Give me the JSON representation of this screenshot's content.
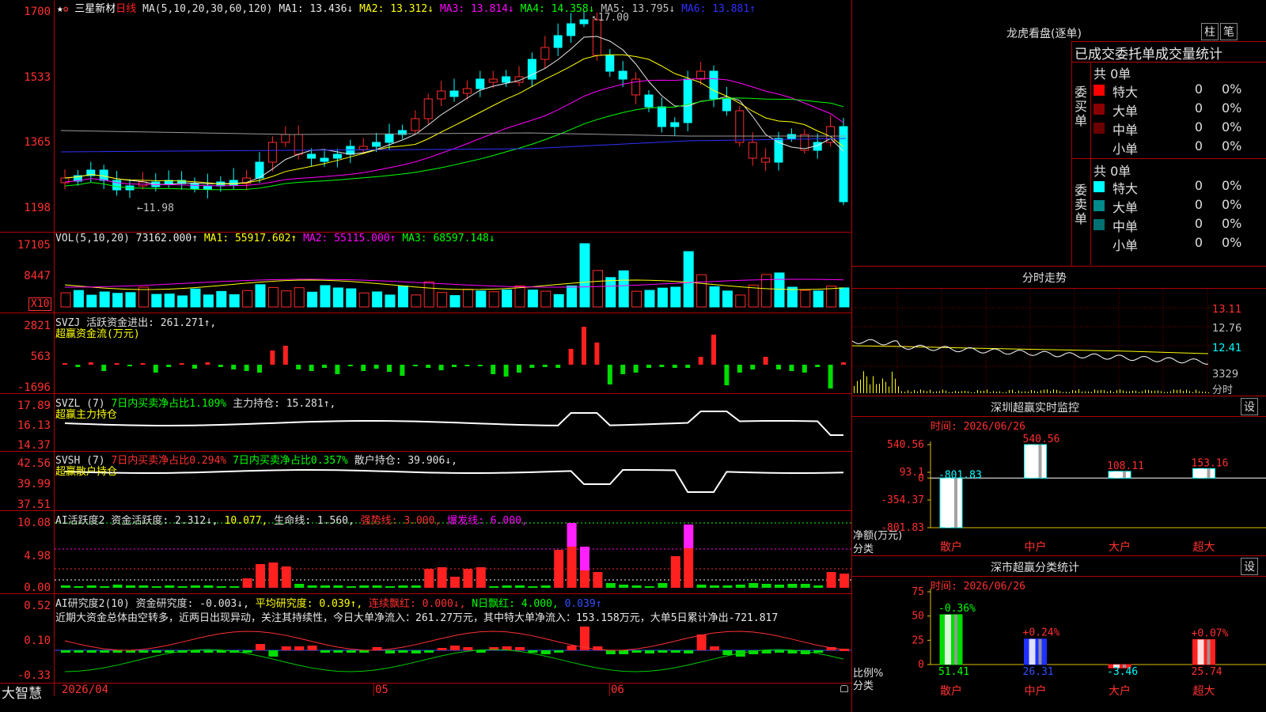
{
  "stock": {
    "name": "三星新材",
    "period": "日线",
    "star": "★",
    "gear": "⚙"
  },
  "ma_header": {
    "prefix": "MA(5,10,20,30,60,120)",
    "items": [
      {
        "t": "MA1: 13.436↓",
        "c": "#e8e8e8"
      },
      {
        "t": "MA2: 13.312↓",
        "c": "#ffff00"
      },
      {
        "t": "MA3: 13.814↓",
        "c": "#ff00ff"
      },
      {
        "t": "MA4: 14.358↓",
        "c": "#00ff00"
      },
      {
        "t": "MA5: 13.795↓",
        "c": "#c0c0c0"
      },
      {
        "t": "MA6: 13.881↑",
        "c": "#3030ff"
      }
    ],
    "high_mark": "17.00",
    "low_mark": "11.98"
  },
  "price_axis": [
    "1700",
    "1533",
    "1365",
    "1198"
  ],
  "vol_header": {
    "prefix": "VOL(5,10,20)",
    "items": [
      {
        "t": "73162.000↑",
        "c": "#e8e8e8"
      },
      {
        "t": "MA1: 55917.602↑",
        "c": "#ffff00"
      },
      {
        "t": "MA2: 55115.000↑",
        "c": "#ff00ff"
      },
      {
        "t": "MA3: 68597.148↓",
        "c": "#00ff00"
      }
    ]
  },
  "vol_axis": [
    "17105",
    "8447"
  ],
  "vol_unit": "X10",
  "svzj": {
    "line1": "SVZJ  活跃资金进出: 261.271↑,",
    "line2": "超赢资金流(万元)"
  },
  "svzj_axis": [
    "2821",
    "563",
    "-1696"
  ],
  "svzl": {
    "name": "SVZL (7)",
    "a": "7日内买卖净占比1.109%",
    "b": "主力持仓: 15.281↑,",
    "line2": "超赢主力持仓"
  },
  "svzl_axis": [
    "17.89",
    "16.13",
    "14.37"
  ],
  "svsh": {
    "name": "SVSH (7)",
    "a": "7日内买卖净占比0.294%",
    "b": "7日内买卖净占比0.357%",
    "c": "散户持仓: 39.906↓,",
    "line2": "超赢散户持仓"
  },
  "svsh_axis": [
    "42.56",
    "39.99",
    "37.51"
  ],
  "ai1": {
    "name": "AI活跃度2",
    "a": "资金活跃度: 2.312↓,",
    "b": "10.077,",
    "c": "生命线: 1.560,",
    "d": "强势线: 3.000,",
    "e": "爆发线: 6.000,"
  },
  "ai1_axis": [
    "10.08",
    "4.98",
    "0.00"
  ],
  "ai2": {
    "name": "AI研究度2(10)",
    "a": "资金研究度: -0.003↓,",
    "b": "平均研究度: 0.039↑,",
    "c": "连续飘红: 0.000↓,",
    "d": "N日飘红: 4.000,",
    "e": "0.039↑",
    "summary": "近期大资金总体由空转多，近两日出现异动，关注其持续性，今日大单净流入：261.27万元，其中特大单净流入：153.158万元，大单5日累计净出-721.817"
  },
  "ai2_axis": [
    "0.52",
    "0.10",
    "-0.33"
  ],
  "dates": [
    "2026/04",
    "05",
    "06"
  ],
  "footer_brand": "大智慧",
  "right": {
    "title": "龙虎看盘(逐单)",
    "btn_zhu": "柱",
    "btn_bi": "笔",
    "subtitle": "已成交委托单成交量统计",
    "buy": {
      "side": "委买单",
      "total": "共 0单",
      "rows": [
        {
          "label": "特大",
          "v": "0",
          "p": "0%",
          "c": "#ff0000"
        },
        {
          "label": "大单",
          "v": "0",
          "p": "0%",
          "c": "#8b0000"
        },
        {
          "label": "中单",
          "v": "0",
          "p": "0%",
          "c": "#6b0000"
        },
        {
          "label": "小单",
          "v": "0",
          "p": "0%",
          "c": ""
        }
      ]
    },
    "sell": {
      "side": "委卖单",
      "total": "共 0单",
      "rows": [
        {
          "label": "特大",
          "v": "0",
          "p": "0%",
          "c": "#00ffff"
        },
        {
          "label": "大单",
          "v": "0",
          "p": "0%",
          "c": "#008b8b"
        },
        {
          "label": "中单",
          "v": "0",
          "p": "0%",
          "c": "#007070"
        },
        {
          "label": "小单",
          "v": "0",
          "p": "0%",
          "c": ""
        }
      ]
    },
    "fenshi": {
      "title": "分时走势",
      "axis": [
        "13.11",
        "12.76",
        "12.41",
        "3329"
      ],
      "unit": "分时"
    },
    "monitor": {
      "title": "深圳超赢实时监控",
      "gear": "设",
      "time": "时间: 2026/06/26",
      "axis": [
        "540.56",
        "93.1",
        "0",
        "-354.37",
        "-801.83"
      ],
      "unit": "净额(万元)",
      "cat_label": "分类"
    },
    "stats": {
      "title": "深市超赢分类统计",
      "gear": "设",
      "time": "时间: 2026/06/26",
      "axis": [
        "75",
        "50",
        "25",
        "0"
      ],
      "unit": "比例%",
      "cat_label": "分类"
    }
  },
  "chart_data": [
    {
      "type": "bar",
      "title": "深圳超赢实时监控",
      "ylabel": "净额(万元)",
      "categories": [
        "散户",
        "中户",
        "大户",
        "超大"
      ],
      "values": [
        -801.83,
        540.56,
        108.11,
        153.16
      ],
      "ylim": [
        -801.83,
        540.56
      ]
    },
    {
      "type": "bar",
      "title": "深市超赢分类统计",
      "ylabel": "比例%",
      "categories": [
        "散户",
        "中户",
        "大户",
        "超大"
      ],
      "values": [
        51.41,
        26.31,
        -3.46,
        25.74
      ],
      "top_labels": [
        "-0.36%",
        "+0.24%",
        "",
        "+0.07%"
      ],
      "ylim": [
        0,
        75
      ]
    }
  ]
}
